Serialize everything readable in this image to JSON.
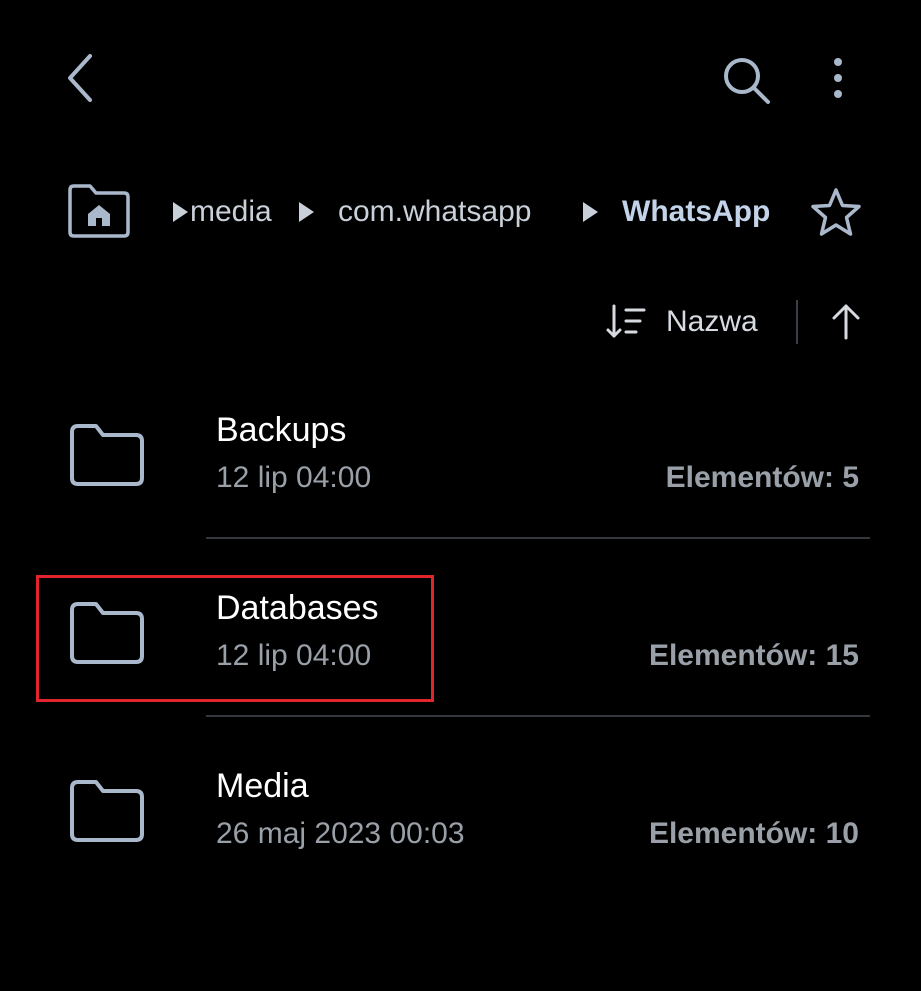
{
  "breadcrumb": {
    "items": [
      {
        "label": "media"
      },
      {
        "label": "com.whatsapp"
      },
      {
        "label": "WhatsApp"
      }
    ]
  },
  "sort": {
    "label": "Nazwa",
    "direction": "ascending"
  },
  "files": [
    {
      "name": "Backups",
      "date": "12 lip 04:00",
      "count": "Elementów: 5"
    },
    {
      "name": "Databases",
      "date": "12 lip 04:00",
      "count": "Elementów: 15"
    },
    {
      "name": "Media",
      "date": "26 maj 2023 00:03",
      "count": "Elementów: 10"
    }
  ],
  "colors": {
    "background": "#000000",
    "icon": "#aab8cc",
    "highlight": "#e0262c"
  },
  "icons": {
    "back": "chevron-left-icon",
    "search": "search-icon",
    "more": "more-vertical-icon",
    "home": "home-folder-icon",
    "star": "star-outline-icon",
    "sort": "sort-icon",
    "sort_direction": "arrow-up-icon",
    "folder": "folder-icon"
  }
}
